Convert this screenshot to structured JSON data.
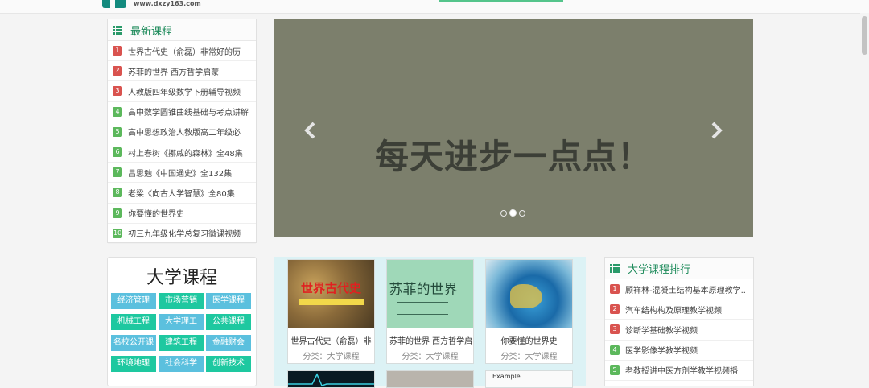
{
  "header": {
    "site_url": "www.dxzy163.com"
  },
  "latest": {
    "title": "最新课程",
    "items": [
      {
        "rank": "1",
        "label": "世界古代史（俞磊）非常好的历"
      },
      {
        "rank": "2",
        "label": "苏菲的世界 西方哲学启蒙"
      },
      {
        "rank": "3",
        "label": "人教版四年级数学下册辅导视频"
      },
      {
        "rank": "4",
        "label": "高中数学圆锥曲线基础与考点讲解"
      },
      {
        "rank": "5",
        "label": "高中思想政治人教版高二年级必"
      },
      {
        "rank": "6",
        "label": "村上春树《挪威的森林》全48集"
      },
      {
        "rank": "7",
        "label": "吕思勉《中国通史》全132集"
      },
      {
        "rank": "8",
        "label": "老梁《向古人学智慧》全80集"
      },
      {
        "rank": "9",
        "label": "你要懂的世界史"
      },
      {
        "rank": "10",
        "label": "初三九年级化学总复习微课视频"
      }
    ]
  },
  "carousel": {
    "slogan": "每天进步一点点！",
    "active_index": 1,
    "slide_count": 3
  },
  "university": {
    "title": "大学课程",
    "tags": [
      {
        "label": "经济管理",
        "color": "blue"
      },
      {
        "label": "市场营销",
        "color": "teal"
      },
      {
        "label": "医学课程",
        "color": "blue"
      },
      {
        "label": "机械工程",
        "color": "teal"
      },
      {
        "label": "大学理工",
        "color": "blue"
      },
      {
        "label": "公共课程",
        "color": "teal"
      },
      {
        "label": "名校公开课",
        "color": "blue"
      },
      {
        "label": "建筑工程",
        "color": "teal"
      },
      {
        "label": "金融财会",
        "color": "blue"
      },
      {
        "label": "环境地理",
        "color": "teal"
      },
      {
        "label": "社会科学",
        "color": "blue"
      },
      {
        "label": "创新技术",
        "color": "teal"
      }
    ]
  },
  "courses": {
    "cards": [
      {
        "title": "世界古代史（俞磊）非",
        "category": "分类：大学课程",
        "cover_text": "世界古代史"
      },
      {
        "title": "苏菲的世界 西方哲学启",
        "category": "分类：大学课程",
        "cover_text": "苏菲的世界"
      },
      {
        "title": "你要懂的世界史",
        "category": "分类：大学课程",
        "cover_text": ""
      }
    ],
    "third_row_label": "Example"
  },
  "ranking": {
    "title": "大学课程排行",
    "items": [
      {
        "rank": "1",
        "label": "顾祥林-混凝土结构基本原理教学.."
      },
      {
        "rank": "2",
        "label": "汽车结构构及原理教学视频"
      },
      {
        "rank": "3",
        "label": "诊断学基础教学视频"
      },
      {
        "rank": "4",
        "label": "医学影像学教学视频"
      },
      {
        "rank": "5",
        "label": "老教授讲中医方剂学教学视频播"
      }
    ]
  },
  "colors": {
    "accent": "#1c8a5a",
    "badge_red": "#d9534f",
    "badge_green": "#5cb85c",
    "carousel_bg": "#7c7f6c"
  }
}
